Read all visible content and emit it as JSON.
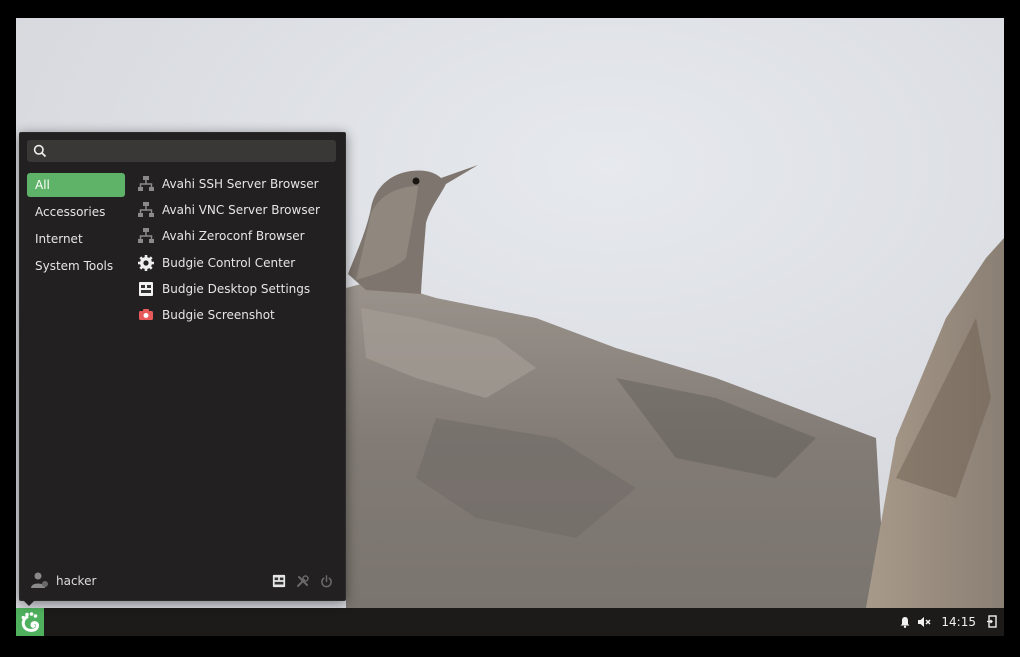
{
  "colors": {
    "accent": "#5fb369",
    "panel": "#1d1b1a",
    "menu_bg": "#222020"
  },
  "menu": {
    "search": {
      "placeholder": "",
      "value": "",
      "icon": "search-icon"
    },
    "categories": [
      {
        "label": "All",
        "active": true
      },
      {
        "label": "Accessories",
        "active": false
      },
      {
        "label": "Internet",
        "active": false
      },
      {
        "label": "System Tools",
        "active": false
      }
    ],
    "apps": [
      {
        "label": "Avahi SSH Server Browser",
        "icon": "network-icon"
      },
      {
        "label": "Avahi VNC Server Browser",
        "icon": "network-icon"
      },
      {
        "label": "Avahi Zeroconf Browser",
        "icon": "network-icon"
      },
      {
        "label": "Budgie Control Center",
        "icon": "gear-icon"
      },
      {
        "label": "Budgie Desktop Settings",
        "icon": "desktop-settings-icon"
      },
      {
        "label": "Budgie Screenshot",
        "icon": "camera-icon"
      }
    ],
    "user": {
      "name": "hacker",
      "icon": "user-avatar-icon"
    },
    "footer_icons": [
      "desktop-settings-icon",
      "tools-icon",
      "power-icon"
    ]
  },
  "panel": {
    "menu_button_icon": "budgie-logo-icon",
    "tray_icons": [
      "notification-bell-icon",
      "volume-muted-icon",
      "logout-icon"
    ],
    "clock": "14:15"
  }
}
